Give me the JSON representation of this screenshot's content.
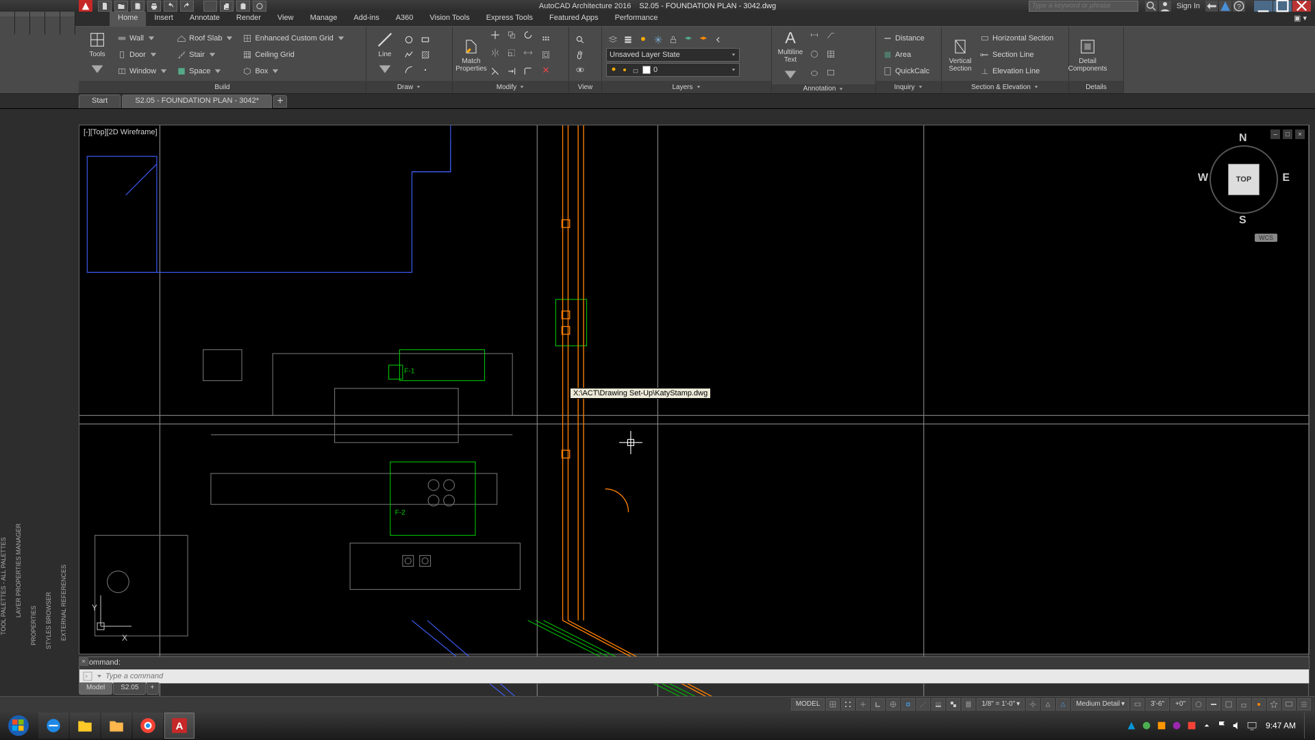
{
  "app": {
    "name": "AutoCAD Architecture 2016",
    "doc": "S2.05 - FOUNDATION PLAN - 3042.dwg",
    "search_placeholder": "Type a keyword or phrase",
    "signin": "Sign In"
  },
  "ribbon_tabs": [
    "Home",
    "Insert",
    "Annotate",
    "Render",
    "View",
    "Manage",
    "Add-ins",
    "A360",
    "Vision Tools",
    "Express Tools",
    "Featured Apps",
    "Performance"
  ],
  "build": {
    "title": "Build",
    "tools": "Tools",
    "wall": "Wall",
    "door": "Door",
    "window": "Window",
    "roofslab": "Roof Slab",
    "stair": "Stair",
    "space": "Space",
    "enhgrid": "Enhanced Custom Grid",
    "ceilgrid": "Ceiling Grid",
    "box": "Box"
  },
  "draw": {
    "title": "Draw",
    "line": "Line"
  },
  "modify": {
    "title": "Modify",
    "match": "Match\nProperties"
  },
  "view": {
    "title": "View"
  },
  "layers": {
    "title": "Layers",
    "state": "Unsaved Layer State",
    "current": "0"
  },
  "annotation": {
    "title": "Annotation",
    "mtext": "Multiline\nText"
  },
  "inquiry": {
    "title": "Inquiry",
    "distance": "Distance",
    "area": "Area",
    "quickcalc": "QuickCalc"
  },
  "section": {
    "title": "Section & Elevation",
    "vsection": "Vertical\nSection",
    "hsection": "Horizontal Section",
    "sline": "Section Line",
    "eline": "Elevation Line"
  },
  "details": {
    "title": "Details",
    "comp": "Detail\nComponents"
  },
  "file_tabs": {
    "start": "Start",
    "doc": "S2.05 - FOUNDATION PLAN - 3042*"
  },
  "viewport": {
    "label": "[-][Top][2D Wireframe]",
    "cube": "TOP",
    "wcs": "WCS"
  },
  "tooltip": "X:\\ACT\\Drawing Set-Up\\KatyStamp.dwg",
  "cmd": {
    "hist": "Command:",
    "placeholder": "Type a command"
  },
  "layout_tabs": {
    "model": "Model",
    "s": "S2.05"
  },
  "status": {
    "model": "MODEL",
    "scale": "1/8\" = 1'-0\"",
    "detail": "Medium Detail",
    "elev": "3'-6\"",
    "cut": "+0\""
  },
  "palettes": [
    "TOOL PALETTES - ALL PALETTES",
    "LAYER PROPERTIES MANAGER",
    "PROPERTIES",
    "STYLES BROWSER",
    "EXTERNAL REFERENCES"
  ],
  "clock": {
    "time": "9:47 AM"
  }
}
